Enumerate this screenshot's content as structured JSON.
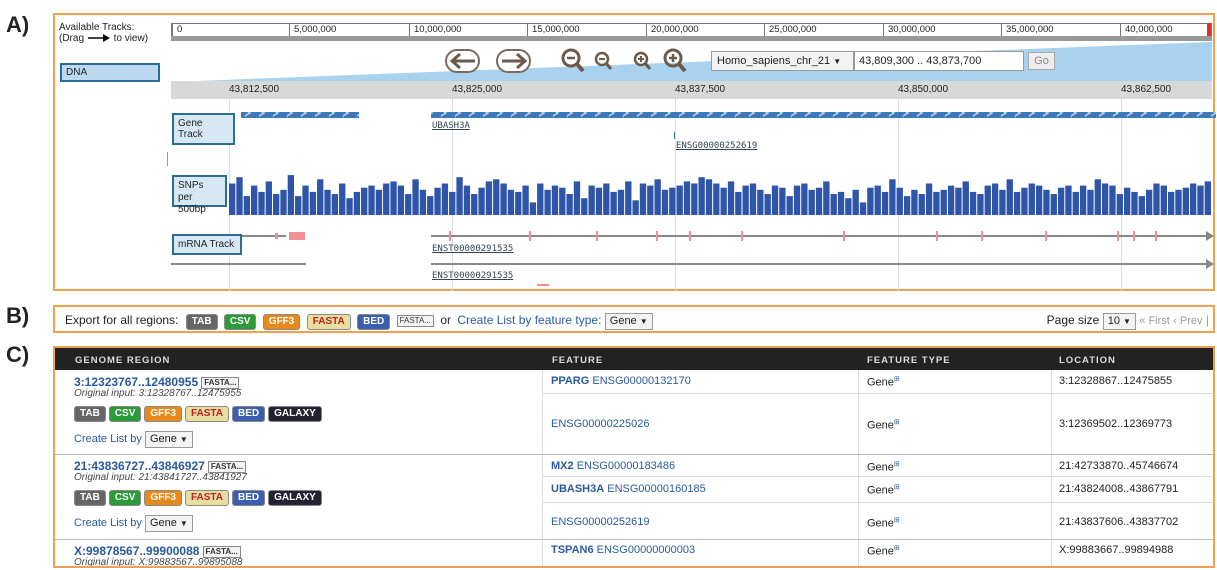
{
  "panel_labels": {
    "a": "A)",
    "b": "B)",
    "c": "C)"
  },
  "browser": {
    "available_tracks": "Available Tracks:",
    "drag_hint_pre": "(Drag",
    "drag_hint_post": "to view)",
    "dna_label": "DNA",
    "ruler_ticks": [
      "0",
      "5,000,000",
      "10,000,000",
      "15,000,000",
      "20,000,000",
      "25,000,000",
      "30,000,000",
      "35,000,000",
      "40,000,000"
    ],
    "chromosome": "Homo_sapiens_chr_21",
    "coords": "43,809,300 .. 43,873,700",
    "go": "Go",
    "scale_ticks": [
      "43,812,500",
      "43,825,000",
      "43,837,500",
      "43,850,000",
      "43,862,500"
    ],
    "gene_track_label": "Gene Track",
    "snp_label_1": "SNPs",
    "snp_label_2": "per 500bp",
    "mrna_label": "mRNA Track",
    "gene1": "UBASH3A",
    "gene2": "ENSG00000252619",
    "tx1": "ENST00000291535",
    "tx2": "ENST00000291535",
    "snp_values": [
      0.75,
      0.9,
      0.45,
      0.7,
      0.55,
      0.8,
      0.5,
      0.6,
      0.95,
      0.45,
      0.7,
      0.55,
      0.85,
      0.6,
      0.5,
      0.75,
      0.4,
      0.55,
      0.65,
      0.7,
      0.6,
      0.75,
      0.8,
      0.7,
      0.5,
      0.85,
      0.6,
      0.45,
      0.65,
      0.75,
      0.55,
      0.9,
      0.7,
      0.5,
      0.65,
      0.8,
      0.85,
      0.75,
      0.6,
      0.55,
      0.7,
      0.3,
      0.75,
      0.6,
      0.7,
      0.65,
      0.5,
      0.8,
      0.4,
      0.7,
      0.65,
      0.75,
      0.55,
      0.6,
      0.8,
      0.35,
      0.75,
      0.7,
      0.85,
      0.6,
      0.65,
      0.7,
      0.8,
      0.75,
      0.9,
      0.85,
      0.75,
      0.65,
      0.8,
      0.55,
      0.7,
      0.75,
      0.6,
      0.5,
      0.7,
      0.65,
      0.45,
      0.7,
      0.75,
      0.6,
      0.65,
      0.8,
      0.5,
      0.55,
      0.4,
      0.6,
      0.3,
      0.65,
      0.7,
      0.55,
      0.85,
      0.65,
      0.45,
      0.6,
      0.5,
      0.75,
      0.55,
      0.6,
      0.7,
      0.65,
      0.8,
      0.55,
      0.5,
      0.7,
      0.75,
      0.6,
      0.85,
      0.55,
      0.65,
      0.75,
      0.7,
      0.6,
      0.5,
      0.65,
      0.7,
      0.55,
      0.7,
      0.6,
      0.85,
      0.75,
      0.7,
      0.5,
      0.65,
      0.55,
      0.45,
      0.6,
      0.75,
      0.7,
      0.55,
      0.6,
      0.65,
      0.75,
      0.7,
      0.8
    ]
  },
  "export": {
    "label": "Export for all regions:",
    "formats": [
      "TAB",
      "CSV",
      "GFF3",
      "FASTA",
      "BED"
    ],
    "fasta_small": "FASTA...",
    "or_text": "or",
    "create_list": "Create List by feature type:",
    "feature_type": "Gene",
    "page_size_label": "Page size",
    "page_size": "10",
    "first": "« First",
    "prev": "‹ Prev",
    "sep": "|"
  },
  "table": {
    "headers": [
      "GENOME REGION",
      "FEATURE",
      "FEATURE TYPE",
      "LOCATION"
    ],
    "regions": [
      {
        "region": "3:12323767..12480955",
        "original": "Original input: 3:12328767..12475955",
        "create": "Create List by",
        "gene_sel": "Gene"
      },
      {
        "region": "21:43836727..43846927",
        "original": "Original input: 21:43841727..43841927",
        "create": "Create List by",
        "gene_sel": "Gene"
      },
      {
        "region": "X:99878567..99900088",
        "original": "Original input: X:99883567..99895088"
      }
    ],
    "region_tags": [
      "TAB",
      "CSV",
      "GFF3",
      "FASTA",
      "BED",
      "GALAXY"
    ],
    "fasta_small": "FASTA...",
    "rows": [
      {
        "name": "PPARG",
        "id": "ENSG00000132170",
        "type": "Gene",
        "loc": "3:12328867..12475855"
      },
      {
        "name": "",
        "id": "ENSG00000225026",
        "type": "Gene",
        "loc": "3:12369502..12369773"
      },
      {
        "name": "MX2",
        "id": "ENSG00000183486",
        "type": "Gene",
        "loc": "21:42733870..45746674"
      },
      {
        "name": "UBASH3A",
        "id": "ENSG00000160185",
        "type": "Gene",
        "loc": "21:43824008..43867791"
      },
      {
        "name": "",
        "id": "ENSG00000252619",
        "type": "Gene",
        "loc": "21:43837606..43837702"
      },
      {
        "name": "TSPAN6",
        "id": "ENSG00000000003",
        "type": "Gene",
        "loc": "X:99883667..99894988"
      }
    ]
  },
  "colors": {
    "accent": "#f0a050",
    "track_blue": "#2f55a8",
    "link": "#2a5a9c"
  }
}
